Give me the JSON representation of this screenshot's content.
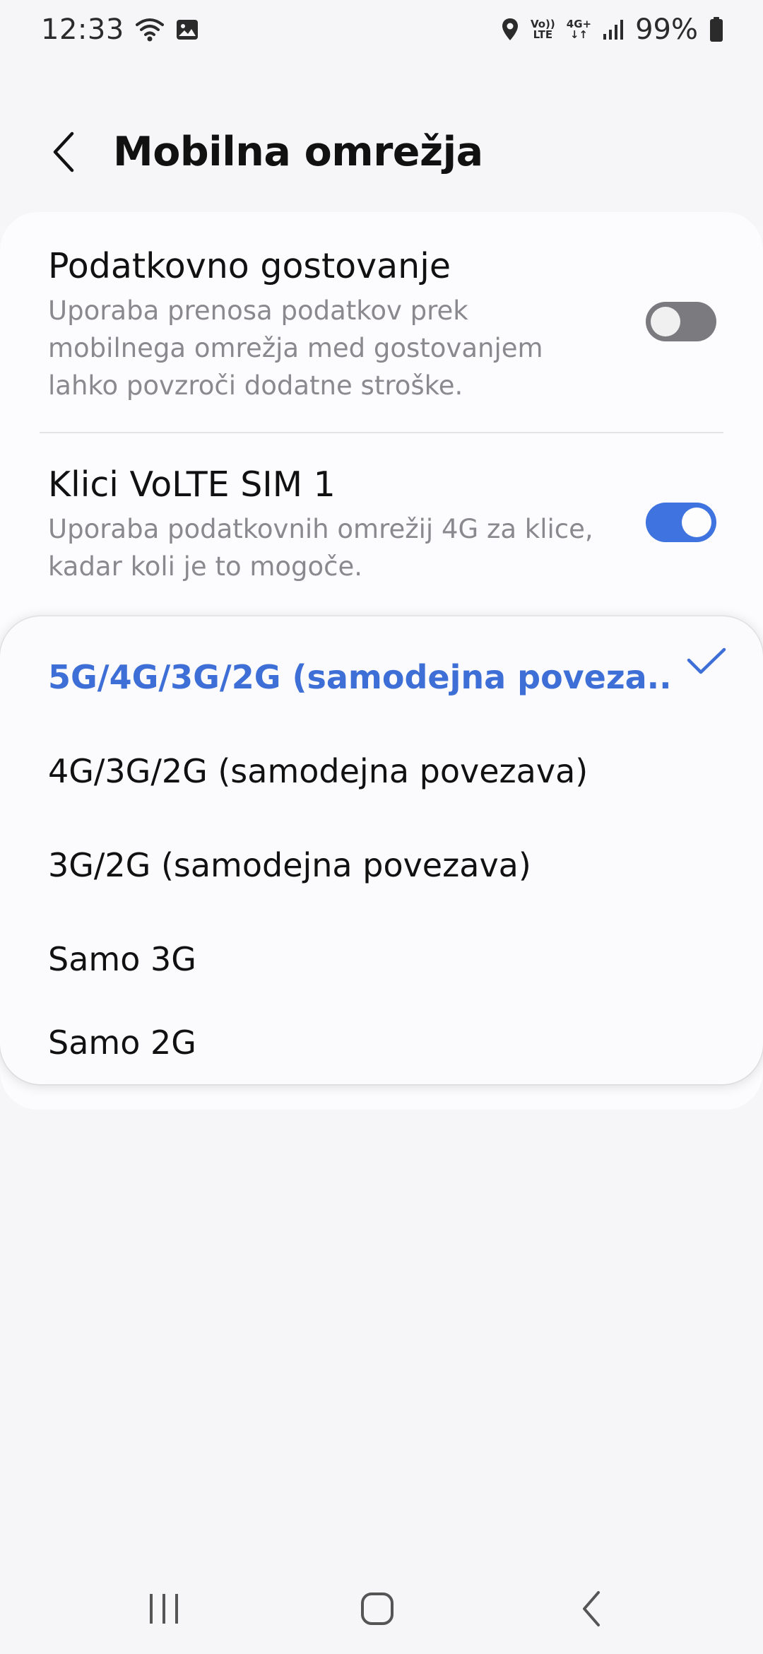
{
  "status_bar": {
    "time": "12:33",
    "battery": "99%",
    "volte_label_top": "Vo))",
    "volte_label_bottom": "LTE",
    "network_label": "4G+",
    "icons": [
      "wifi-icon",
      "gallery-icon",
      "location-icon",
      "volte-icon",
      "network-4g-plus-icon",
      "signal-icon",
      "battery-icon"
    ]
  },
  "header": {
    "title": "Mobilna omrežja",
    "back_icon": "back-chevron-icon"
  },
  "settings": {
    "roaming": {
      "title": "Podatkovno gostovanje",
      "description": "Uporaba prenosa podatkov prek mobilnega omrežja med gostovanjem lahko povzroči dodatne stroške.",
      "enabled": false
    },
    "volte": {
      "title": "Klici VoLTE SIM 1",
      "description": "Uporaba podatkovnih omrežij 4G za klice, kadar koli je to mogoče.",
      "enabled": true
    }
  },
  "network_mode_menu": {
    "selected_index": 0,
    "options": [
      "5G/4G/3G/2G (samodejna poveza..",
      "4G/3G/2G (samodejna povezava)",
      "3G/2G (samodejna povezava)",
      "Samo 3G",
      "Samo 2G"
    ],
    "check_icon": "check-icon"
  },
  "nav_bar": {
    "icons": [
      "recent-apps-icon",
      "home-icon",
      "back-icon"
    ]
  },
  "colors": {
    "accent": "#3e73e0",
    "selected_text": "#3e6fd6",
    "background": "#f6f6f8",
    "card": "#fcfcfe",
    "secondary_text": "#8a8a8e"
  }
}
